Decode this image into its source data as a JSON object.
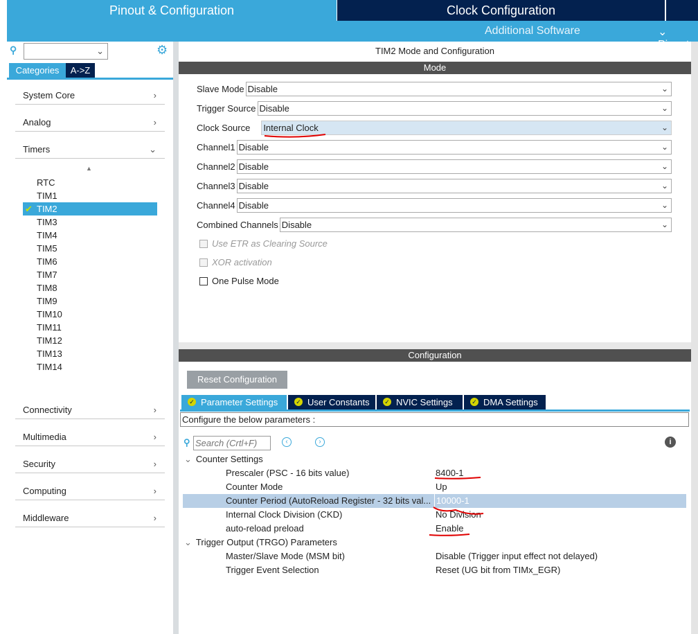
{
  "top_tabs": [
    "Pinout & Configuration",
    "Clock Configuration"
  ],
  "sub_menu": {
    "additional_software": "Additional Software",
    "pinout": "Pinout"
  },
  "sidebar": {
    "tabs": [
      "Categories",
      "A->Z"
    ],
    "categories_top": [
      "System Core",
      "Analog",
      "Timers"
    ],
    "timers": [
      "RTC",
      "TIM1",
      "TIM2",
      "TIM3",
      "TIM4",
      "TIM5",
      "TIM6",
      "TIM7",
      "TIM8",
      "TIM9",
      "TIM10",
      "TIM11",
      "TIM12",
      "TIM13",
      "TIM14"
    ],
    "selected_timer": "TIM2",
    "categories_bottom": [
      "Connectivity",
      "Multimedia",
      "Security",
      "Computing",
      "Middleware"
    ]
  },
  "main": {
    "title": "TIM2 Mode and Configuration",
    "mode_header": "Mode",
    "mode_fields": [
      {
        "label": "Slave Mode",
        "value": "Disable"
      },
      {
        "label": "Trigger Source",
        "value": "Disable"
      },
      {
        "label": "Clock Source",
        "value": "Internal Clock"
      },
      {
        "label": "Channel1",
        "value": "Disable"
      },
      {
        "label": "Channel2",
        "value": "Disable"
      },
      {
        "label": "Channel3",
        "value": "Disable"
      },
      {
        "label": "Channel4",
        "value": "Disable"
      },
      {
        "label": "Combined Channels",
        "value": "Disable"
      }
    ],
    "checkboxes": [
      {
        "label": "Use ETR as Clearing Source",
        "checked": false,
        "disabled": true
      },
      {
        "label": "XOR activation",
        "checked": false,
        "disabled": true
      },
      {
        "label": "One Pulse Mode",
        "checked": false,
        "disabled": false
      }
    ],
    "config_header": "Configuration",
    "reset_button": "Reset Configuration",
    "param_tabs": [
      "Parameter Settings",
      "User Constants",
      "NVIC Settings",
      "DMA Settings"
    ],
    "configure_text": "Configure the below parameters :",
    "search_placeholder": "Search (Crtl+F)",
    "groups": [
      {
        "name": "Counter Settings",
        "params": [
          {
            "key": "Prescaler (PSC - 16 bits value)",
            "value": "8400-1"
          },
          {
            "key": "Counter Mode",
            "value": "Up"
          },
          {
            "key": "Counter Period (AutoReload Register - 32 bits val...",
            "value": "10000-1"
          },
          {
            "key": "Internal Clock Division (CKD)",
            "value": "No Division"
          },
          {
            "key": "auto-reload preload",
            "value": "Enable"
          }
        ]
      },
      {
        "name": "Trigger Output (TRGO) Parameters",
        "params": [
          {
            "key": "Master/Slave Mode (MSM bit)",
            "value": "Disable (Trigger input effect not delayed)"
          },
          {
            "key": "Trigger Event Selection",
            "value": "Reset (UG bit from TIMx_EGR)"
          }
        ]
      }
    ]
  },
  "colors": {
    "light_blue": "#3aa8da",
    "dark_navy": "#03214f",
    "header_gray": "#505050",
    "selected_row": "#b8cfe6",
    "annotation_red": "#e00000"
  }
}
